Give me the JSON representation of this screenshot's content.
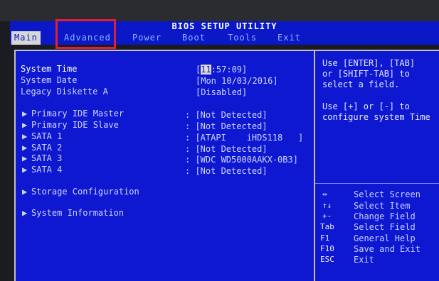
{
  "title": "BIOS SETUP UTILITY",
  "menu": [
    {
      "label": "Main",
      "active": true
    },
    {
      "label": "Advanced",
      "active": false
    },
    {
      "label": "Power",
      "active": false
    },
    {
      "label": "Boot",
      "active": false
    },
    {
      "label": "Tools",
      "active": false
    },
    {
      "label": "Exit",
      "active": false
    }
  ],
  "settings": {
    "system_time": {
      "label": "System Time",
      "value_open": "[",
      "value_hl": "11",
      "value_rest": ":57:09]"
    },
    "system_date": {
      "label": "System Date",
      "value": "[Mon 10/03/2016]"
    },
    "legacy_diskette": {
      "label": "Legacy Diskette A",
      "value": "[Disabled]"
    }
  },
  "ide": [
    {
      "label": "Primary IDE Master",
      "value": ": [Not Detected]"
    },
    {
      "label": "Primary IDE Slave",
      "value": ": [Not Detected]"
    },
    {
      "label": "SATA 1",
      "value": ": [ATAPI    iHDS118   ]"
    },
    {
      "label": "SATA 2",
      "value": ": [Not Detected]"
    },
    {
      "label": "SATA 3",
      "value": ": [WDC WD5000AAKX-0B3]"
    },
    {
      "label": "SATA 4",
      "value": ": [Not Detected]"
    }
  ],
  "submenus": {
    "storage": "Storage Configuration",
    "system_info": "System Information"
  },
  "help": {
    "line1": "Use [ENTER], [TAB]",
    "line2": "or [SHIFT-TAB] to",
    "line3": "select a field.",
    "line4": "Use [+] or [-] to",
    "line5": "configure system Time"
  },
  "keys": [
    {
      "key": "↔",
      "desc": "Select Screen"
    },
    {
      "key": "↑↓",
      "desc": "Select Item"
    },
    {
      "key": "+-",
      "desc": "Change Field"
    },
    {
      "key": "Tab",
      "desc": "Select Field"
    },
    {
      "key": "F1",
      "desc": "General Help"
    },
    {
      "key": "F10",
      "desc": "Save and Exit"
    },
    {
      "key": "ESC",
      "desc": "Exit"
    }
  ],
  "colors": {
    "background": "#0e18d0",
    "title_bar": "#0a18c8",
    "highlight": "#d9d9d9",
    "annotation_box": "#e02030"
  }
}
